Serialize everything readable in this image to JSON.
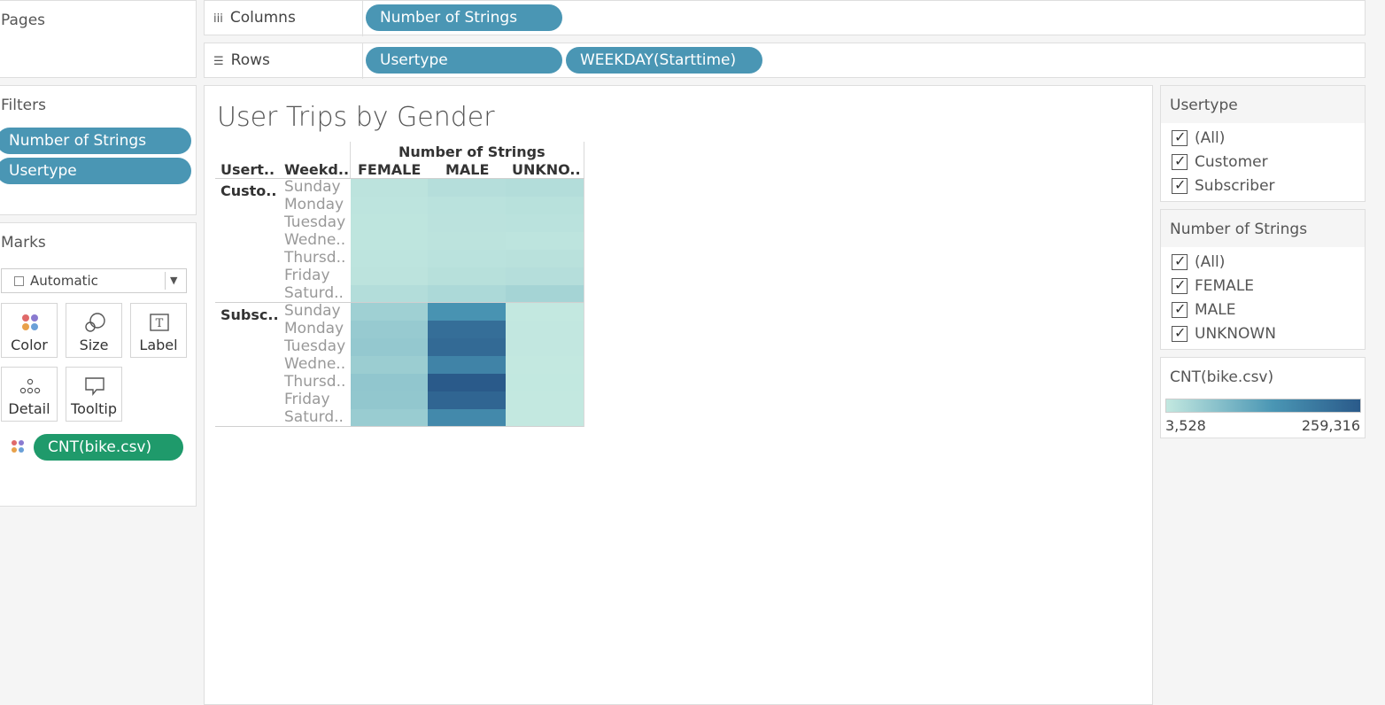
{
  "pages_title": "Pages",
  "columns": {
    "label": "Columns",
    "pills": [
      "Number of Strings"
    ]
  },
  "rows": {
    "label": "Rows",
    "pills": [
      "Usertype",
      "WEEKDAY(Starttime)"
    ]
  },
  "filters": {
    "title": "Filters",
    "pills": [
      "Number of Strings",
      "Usertype"
    ]
  },
  "marks": {
    "title": "Marks",
    "type": "Automatic",
    "buttons": [
      "Color",
      "Size",
      "Label",
      "Detail",
      "Tooltip"
    ],
    "field": "CNT(bike.csv)"
  },
  "colors": {
    "pill_blue": "#4a96b4",
    "pill_green": "#1f9a6b",
    "ramp_low": "#c3e8e0",
    "ramp_high": "#2a5a8a"
  },
  "chart_data": {
    "type": "heatmap",
    "title": "User Trips by Gender",
    "column_header": "Number of Strings",
    "row_headers": [
      "Usert..",
      "Weekd.."
    ],
    "columns": [
      "FEMALE",
      "MALE",
      "UNKNO.."
    ],
    "groups": [
      {
        "name": "Custo..",
        "days": [
          "Sunday",
          "Monday",
          "Tuesday",
          "Wedne..",
          "Thursd..",
          "Friday",
          "Saturd.."
        ],
        "values": [
          [
            12000,
            20000,
            22000
          ],
          [
            10000,
            14000,
            16000
          ],
          [
            9000,
            13000,
            14000
          ],
          [
            9000,
            12000,
            11000
          ],
          [
            10000,
            14000,
            15000
          ],
          [
            12000,
            18000,
            20000
          ],
          [
            22000,
            30000,
            38000
          ]
        ]
      },
      {
        "name": "Subsc..",
        "days": [
          "Sunday",
          "Monday",
          "Tuesday",
          "Wedne..",
          "Thursd..",
          "Friday",
          "Saturd.."
        ],
        "values": [
          [
            45000,
            150000,
            4000
          ],
          [
            55000,
            220000,
            4500
          ],
          [
            58000,
            228000,
            4500
          ],
          [
            50000,
            180000,
            3800
          ],
          [
            62000,
            259316,
            4200
          ],
          [
            60000,
            238000,
            4000
          ],
          [
            52000,
            170000,
            3528
          ]
        ]
      }
    ],
    "color_range": [
      3528,
      259316
    ]
  },
  "legend_usertype": {
    "title": "Usertype",
    "items": [
      "(All)",
      "Customer",
      "Subscriber"
    ]
  },
  "legend_strings": {
    "title": "Number of Strings",
    "items": [
      "(All)",
      "FEMALE",
      "MALE",
      "UNKNOWN"
    ]
  },
  "legend_color": {
    "title": "CNT(bike.csv)",
    "min_label": "3,528",
    "max_label": "259,316"
  }
}
